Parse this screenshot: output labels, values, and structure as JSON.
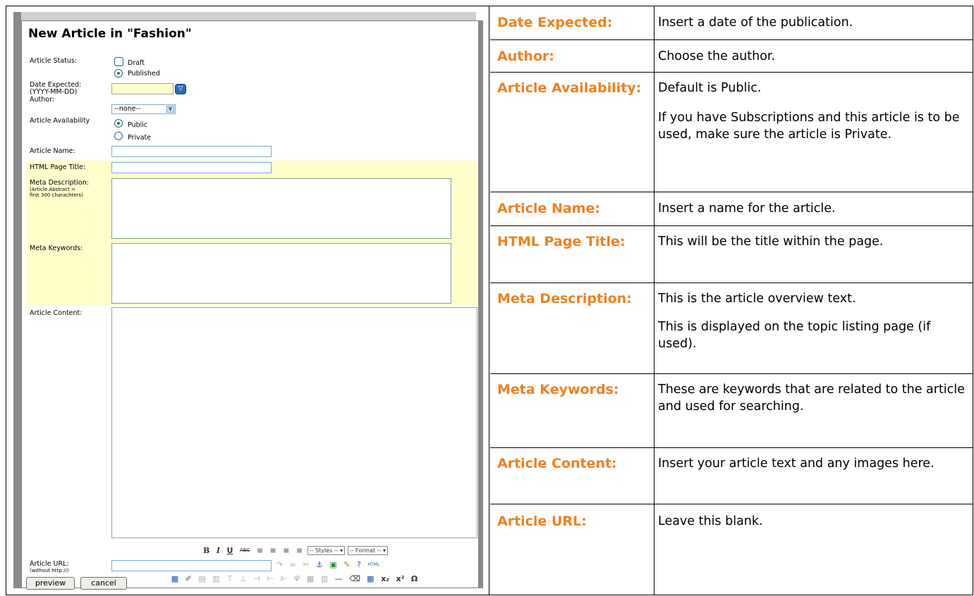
{
  "form": {
    "title": "New Article in \"Fashion\"",
    "labels": {
      "status": "Article Status:",
      "date": "Date Expected:",
      "date_format": "(YYYY-MM-DD)",
      "author": "Author:",
      "availability": "Article Availability",
      "name": "Article Name:",
      "html_title": "HTML Page Title:",
      "meta_desc_1": "Meta Description:",
      "meta_desc_2": "(Article Abstract =",
      "meta_desc_3": "first 300 charachters)",
      "meta_keywords": "Meta Keywords:",
      "content": "Article Content:",
      "url": "Article URL:",
      "url_hint": "(without http://)"
    },
    "status_options": {
      "draft": "Draft",
      "published": "Published"
    },
    "availability_options": {
      "public": "Public",
      "private": "Private"
    },
    "author_selected": "--none--",
    "toolbar": {
      "styles": "-- Styles --",
      "format": "-- Format --"
    },
    "buttons": {
      "preview": "preview",
      "cancel": "cancel"
    }
  },
  "help_table": {
    "rows": [
      {
        "label": "Date Expected:",
        "desc": [
          "Insert a date of the publication."
        ]
      },
      {
        "label": "Author:",
        "desc": [
          "Choose the author."
        ]
      },
      {
        "label": "Article Availability:",
        "desc": [
          "Default is Public.",
          "If you have Subscriptions and this article is to be used, make sure the article is Private."
        ]
      },
      {
        "label": "Article Name:",
        "desc": [
          "Insert a name for the article."
        ]
      },
      {
        "label": "HTML Page Title:",
        "desc": [
          "This will be the title within the page."
        ]
      },
      {
        "label": "Meta Description:",
        "desc": [
          "This is the article overview text.",
          "This is displayed on the topic listing page (if used)."
        ]
      },
      {
        "label": "Meta Keywords:",
        "desc": [
          "These are keywords that are related to the article and used for searching."
        ]
      },
      {
        "label": "Article Content:",
        "desc": [
          "Insert your article text and any images here."
        ]
      },
      {
        "label": "Article URL:",
        "desc": [
          "Leave this blank."
        ]
      }
    ]
  },
  "colors": {
    "label_orange": "#f08020",
    "yellow_band": "#ffffcc"
  }
}
